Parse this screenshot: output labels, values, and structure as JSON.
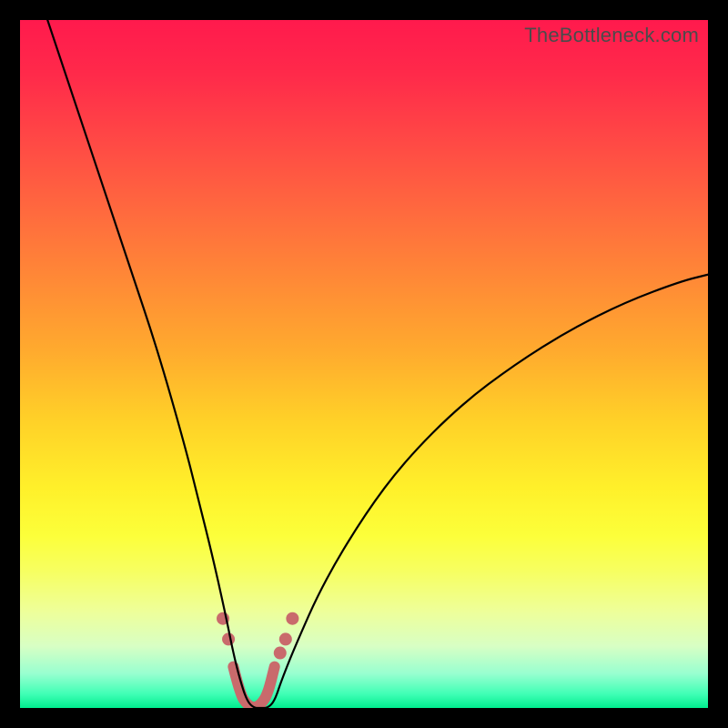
{
  "attribution": "TheBottleneck.com",
  "colors": {
    "bg": "#000000",
    "gradient_top": "#ff1a4d",
    "gradient_bottom": "#00ed8e",
    "curve": "#000000",
    "marker": "#c96a6c"
  },
  "chart_data": {
    "type": "line",
    "title": "",
    "xlabel": "",
    "ylabel": "",
    "xlim": [
      0,
      100
    ],
    "ylim": [
      0,
      100
    ],
    "series": [
      {
        "name": "bottleneck-curve",
        "x": [
          4,
          8,
          12,
          16,
          20,
          24,
          26,
          28,
          30,
          31,
          32,
          33,
          34,
          35,
          36,
          37,
          38,
          40,
          44,
          50,
          56,
          64,
          72,
          80,
          88,
          96,
          100
        ],
        "values": [
          100,
          88,
          76,
          64,
          52,
          38,
          30,
          22,
          13,
          8,
          4,
          1,
          0,
          0,
          0,
          1,
          4,
          9,
          18,
          28,
          36,
          44,
          50,
          55,
          59,
          62,
          63
        ]
      }
    ],
    "markers": {
      "line": {
        "x": [
          31,
          32,
          33,
          34,
          35,
          36,
          37
        ],
        "y": [
          6,
          2,
          0.5,
          0,
          0.5,
          2,
          6
        ]
      },
      "dots_left": [
        {
          "x": 29.5,
          "y": 13
        },
        {
          "x": 30.3,
          "y": 10
        }
      ],
      "dots_right": [
        {
          "x": 37.8,
          "y": 8
        },
        {
          "x": 38.6,
          "y": 10
        },
        {
          "x": 39.6,
          "y": 13
        }
      ]
    }
  }
}
